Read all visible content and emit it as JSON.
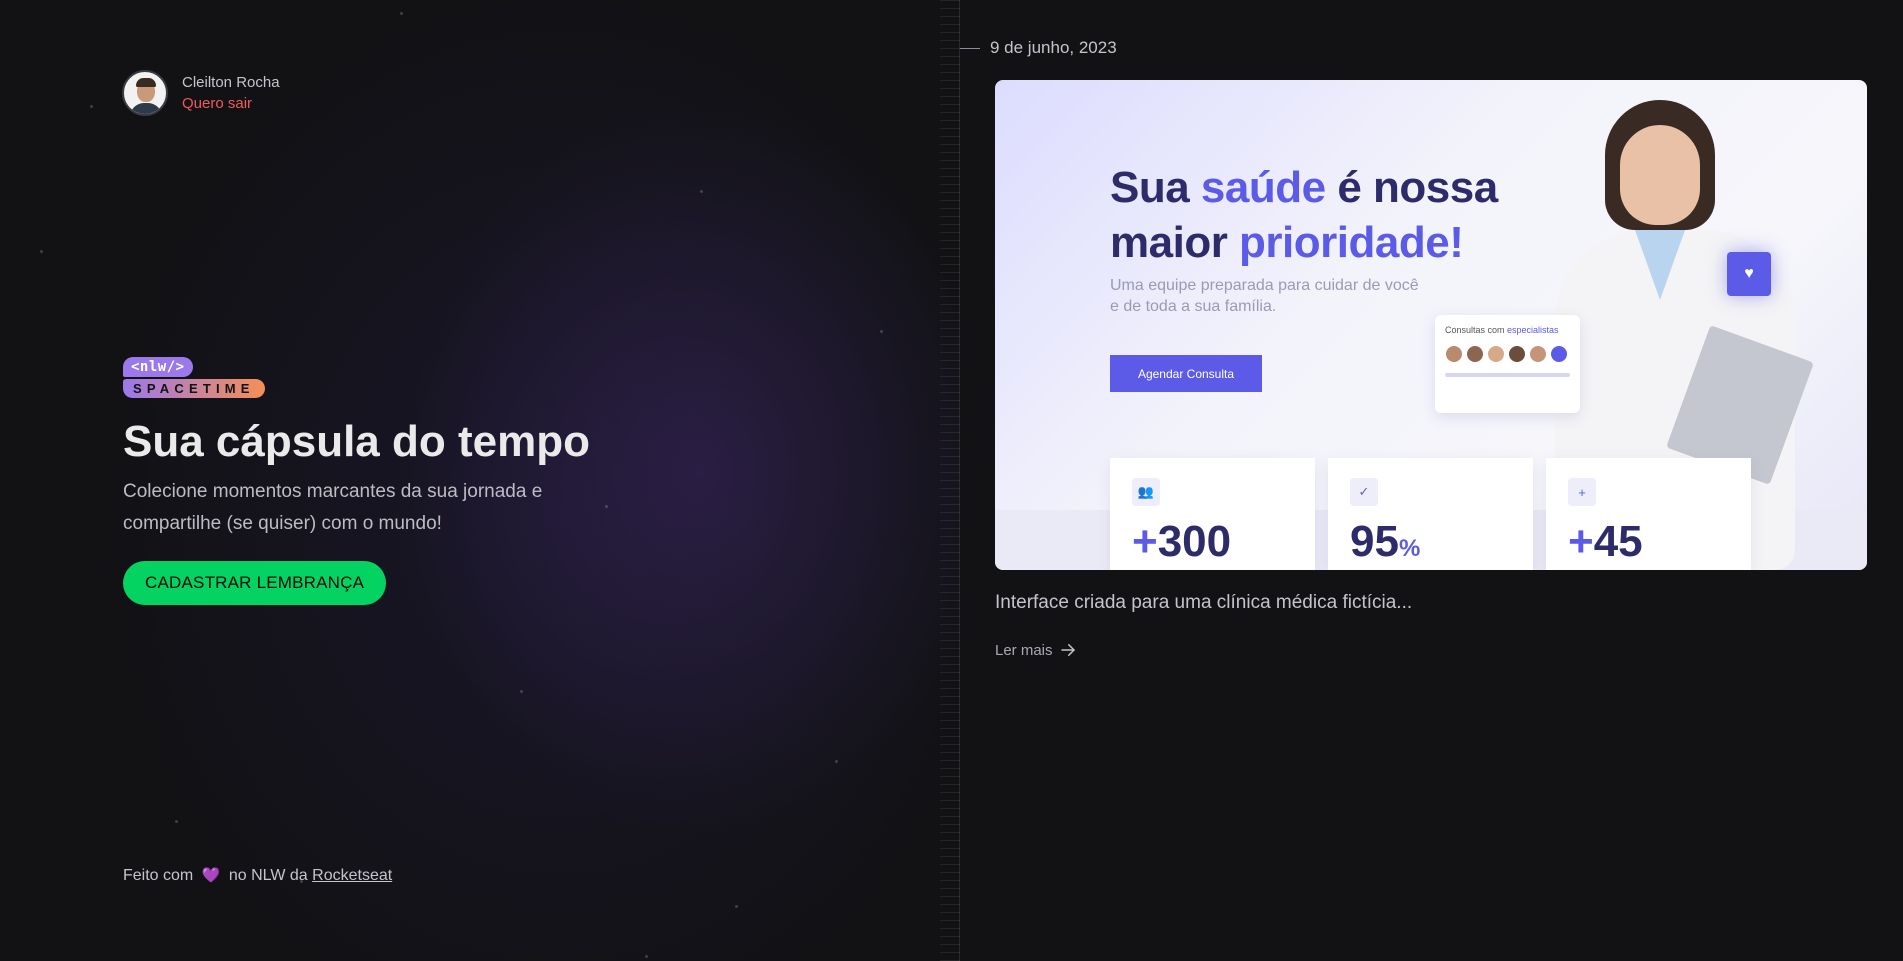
{
  "profile": {
    "name": "Cleilton Rocha",
    "logout_label": "Quero sair"
  },
  "logo": {
    "top": "<nlw/>",
    "bottom": "SPACETIME"
  },
  "hero": {
    "title": "Sua cápsula do tempo",
    "subtitle": "Colecione momentos marcantes da sua jornada e compartilhe (se quiser) com o mundo!",
    "cta_label": "CADASTRAR LEMBRANÇA"
  },
  "footer": {
    "prefix": "Feito com",
    "heart_icon": "heart-icon",
    "middle": "no NLW da",
    "link_label": "Rocketseat"
  },
  "memory": {
    "date": "9 de junho, 2023",
    "image": {
      "heading_part1": "Sua ",
      "heading_accent1": "saúde",
      "heading_part2": " é nossa",
      "heading_part3": "maior ",
      "heading_accent2": "prioridade!",
      "subtitle": "Uma equipe preparada para cuidar de você e de toda a sua família.",
      "button_label": "Agendar Consulta",
      "card_title": "Consultas com ",
      "card_title_accent": "especialistas",
      "stats": [
        {
          "prefix": "+",
          "value": "300",
          "icon": "users-icon"
        },
        {
          "prefix": "",
          "value": "95",
          "suffix": "%",
          "icon": "check-icon"
        },
        {
          "prefix": "+",
          "value": "45",
          "icon": "user-plus-icon"
        }
      ]
    },
    "excerpt": "Interface criada para uma clínica médica fictícia...",
    "read_more_label": "Ler mais"
  },
  "colors": {
    "background": "#121215",
    "accent_green": "#04d361",
    "logout_red": "#ef5a5a",
    "purple": "#8257e5"
  }
}
